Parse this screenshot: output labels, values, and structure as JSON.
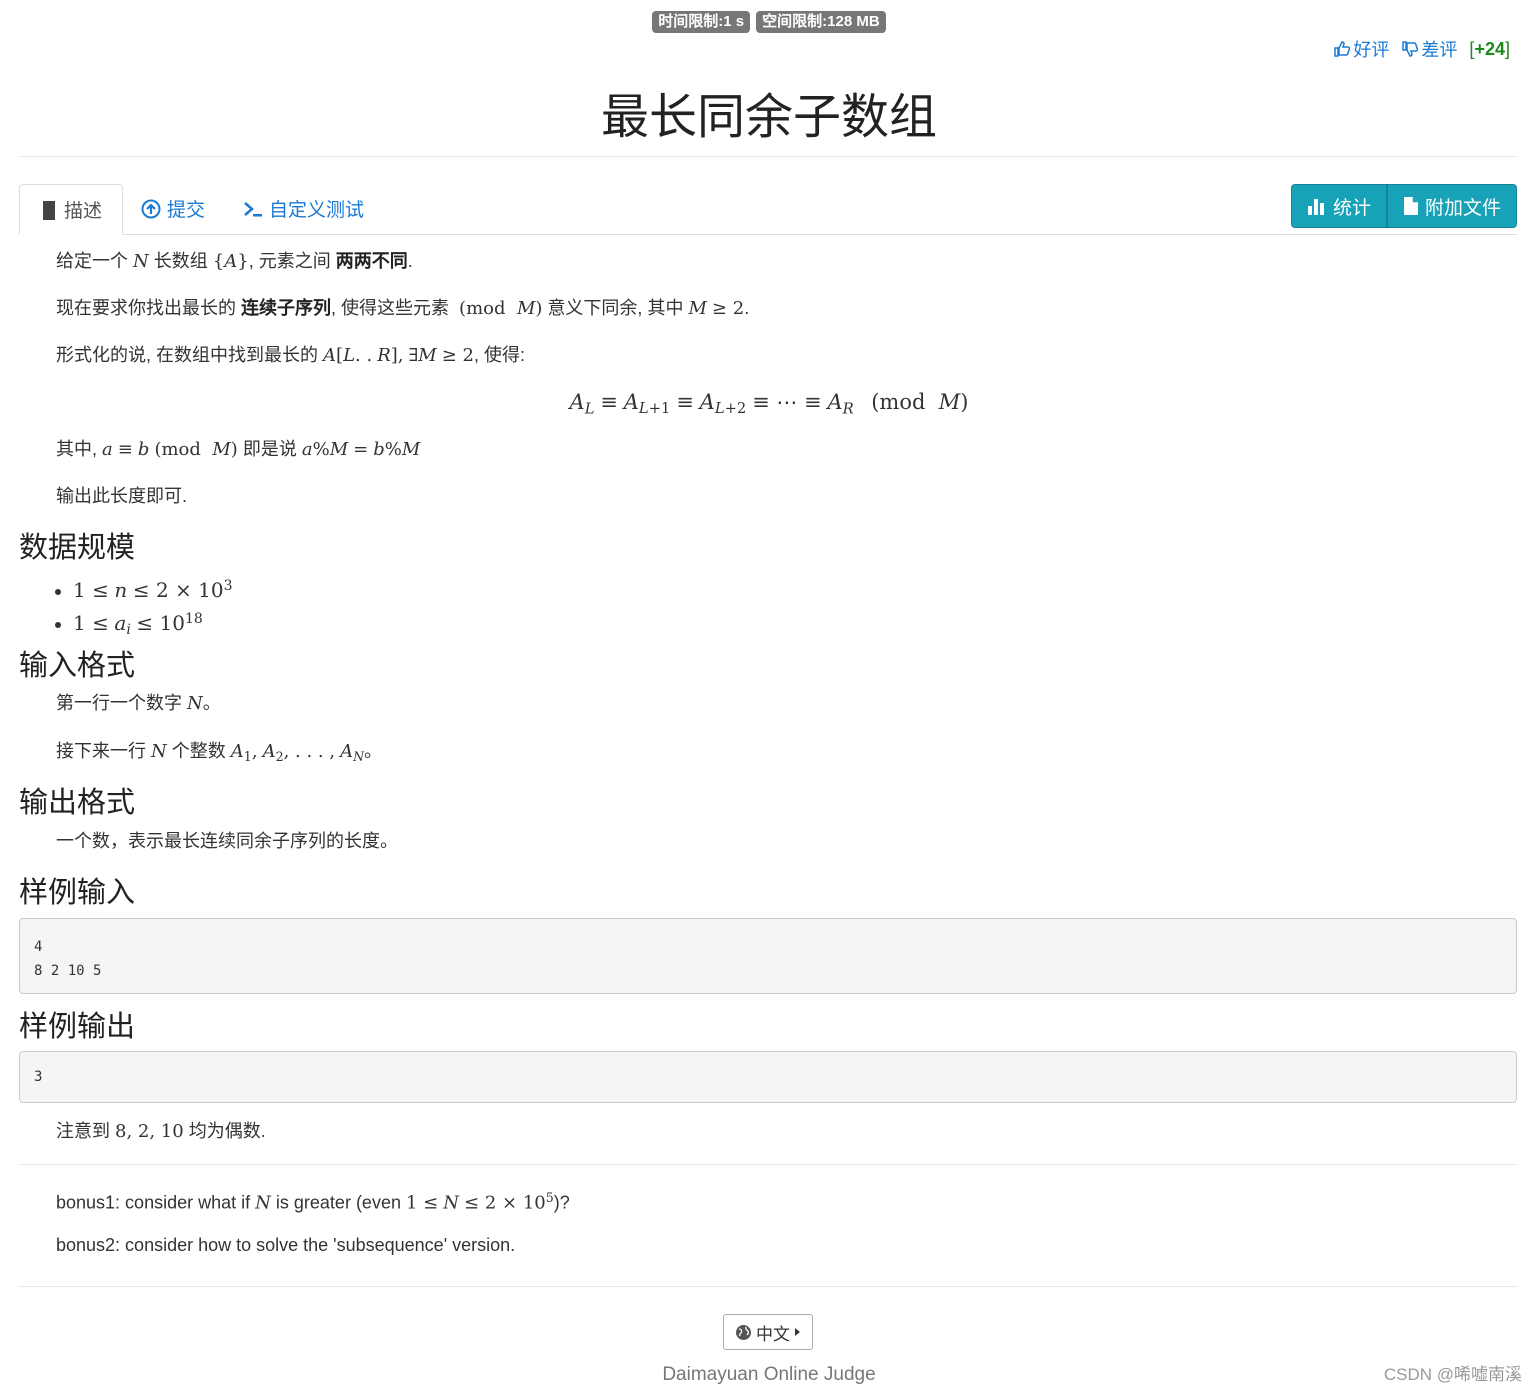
{
  "limits": {
    "time": "时间限制:1 s",
    "memory": "空间限制:128 MB"
  },
  "votes": {
    "good": "好评",
    "bad": "差评",
    "score_open": "[",
    "score": "+24",
    "score_close": "]"
  },
  "title": "最长同余子数组",
  "tabs": [
    {
      "label": "描述"
    },
    {
      "label": "提交"
    },
    {
      "label": "自定义测试"
    }
  ],
  "buttons": {
    "stats": "统计",
    "attach": "附加文件"
  },
  "desc": {
    "p1a": "给定一个",
    "p1b": "长数组",
    "p1c": ", 元素之间",
    "p1bold": "两两不同",
    "p1d": ".",
    "p2a": "现在要求你找出最长的",
    "p2bold": "连续子序列",
    "p2b": ", 使得这些元素",
    "p2c": "意义下同余, 其中",
    "p2d": ".",
    "p3a": "形式化的说, 在数组中找到最长的",
    "p3b": ", 使得:",
    "p4a": "其中,",
    "p4b": "即是说",
    "p5": "输出此长度即可."
  },
  "sections": {
    "scale": "数据规模",
    "input": "输入格式",
    "output": "输出格式",
    "sample_in": "样例输入",
    "sample_out": "样例输出"
  },
  "input_fmt": {
    "l1a": "第一行一个数字",
    "l1b": "。",
    "l2a": "接下来一行",
    "l2b": "个整数",
    "l2c": "。"
  },
  "output_fmt": "一个数，表示最长连续同余子序列的长度。",
  "sample_input": "4\n8 2 10 5",
  "sample_output": "3",
  "note": {
    "a": "注意到",
    "b": "均为偶数."
  },
  "bonus": {
    "b1a": "bonus1: consider what if",
    "b1b": "is greater (even",
    "b1c": ")?",
    "b2": "bonus2: consider how to solve the 'subsequence' version."
  },
  "lang": "中文",
  "footer": "Daimayuan Online Judge",
  "watermark": "CSDN @唏嘘南溪",
  "colors": {
    "link": "#1a7ad4",
    "info_button": "#17a2b8",
    "badge": "#777777",
    "score": "#1a8a1a"
  }
}
